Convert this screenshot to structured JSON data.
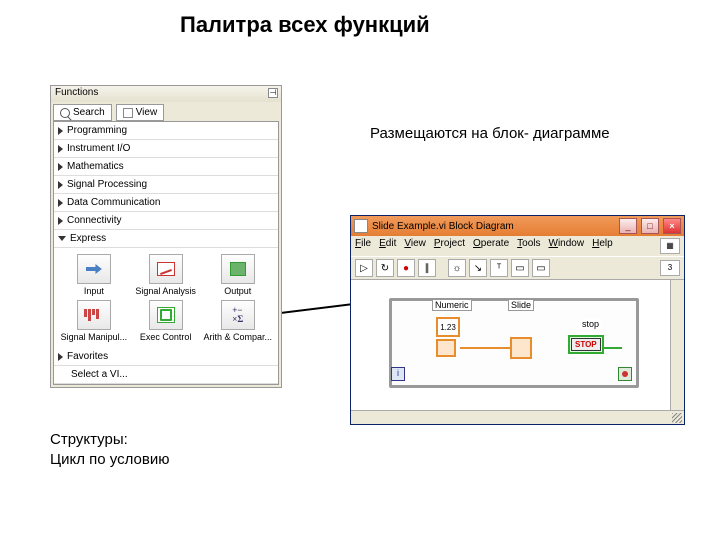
{
  "heading": "Палитра всех функций",
  "caption_right": "Размещаются на блок- диаграмме",
  "caption_left_1": "Структуры:",
  "caption_left_2": "Цикл по условию",
  "palette": {
    "title": "Functions",
    "tab_search": "Search",
    "tab_view": "View",
    "pin": "⊣",
    "categories": [
      "Programming",
      "Instrument I/O",
      "Mathematics",
      "Signal Processing",
      "Data Communication",
      "Connectivity"
    ],
    "express": "Express",
    "subpalette": {
      "input": "Input",
      "sig_analysis": "Signal Analysis",
      "output": "Output",
      "sig_manip": "Signal Manipul...",
      "exec_ctrl": "Exec Control",
      "arith": "Arith & Compar..."
    },
    "favorites": "Favorites",
    "select_vi": "Select a VI..."
  },
  "bd": {
    "title": "Slide Example.vi Block Diagram",
    "menu": {
      "file": "File",
      "edit": "Edit",
      "view": "View",
      "project": "Project",
      "operate": "Operate",
      "tools": "Tools",
      "window": "Window",
      "help": "Help"
    },
    "toolbar": {
      "run": "▷",
      "runcont": "↻",
      "abort": "●",
      "pause": "∥",
      "hilite": "☼",
      "step": "↘",
      "font": "ᵀ",
      "align": "▭",
      "dist": "▭"
    },
    "appicon": "⬚",
    "appnum": "3",
    "nodes": {
      "numeric_label": "Numeric",
      "numeric_val": "1.23",
      "slide_label": "Slide",
      "stop_label": "stop",
      "stop_text": "STOP",
      "i": "i"
    }
  }
}
